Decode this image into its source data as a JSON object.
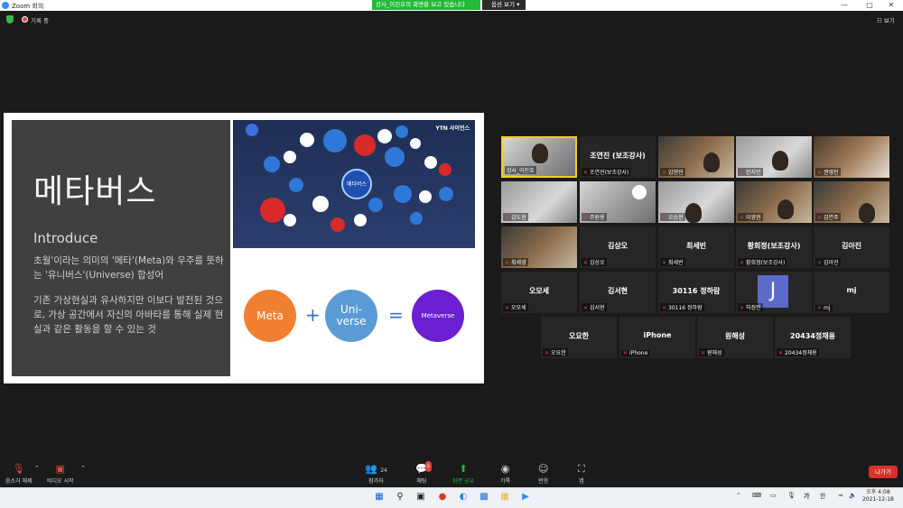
{
  "window": {
    "title": "Zoom 회의",
    "share_banner": "강사_이진호의 화면을 보고 있습니다",
    "view_options": "옵션 보기"
  },
  "top": {
    "recording_label": "기록 중",
    "view_label": "보기"
  },
  "slide": {
    "title": "메타버스",
    "subtitle": "Introduce",
    "para1": "초월'이라는 의미의 '메타'(Meta)와 우주를 뜻하는 '유니버스'(Universe) 합성어",
    "para2": "기존 가상현실과 유사하지만 이보다 발전된 것으로, 가상 공간에서 자신의 아바타를 통해 실제 현실과 같은 활동을 할 수 있는 것",
    "image_badge": "YTN 사이언스",
    "image_center": "메타버스",
    "circle1": "Meta",
    "circle2_line1": "Uni-",
    "circle2_line2": "verse",
    "circle3": "Metaverse",
    "plus": "+",
    "equals": "="
  },
  "participants": [
    {
      "name": "강사_이진호",
      "label": "",
      "video": true
    },
    {
      "name": "조연진(보조강사)",
      "label": "조연진 (보조강사)",
      "video": false
    },
    {
      "name": "김현민",
      "label": "",
      "video": true
    },
    {
      "name": "한지민",
      "label": "",
      "video": true
    },
    {
      "name": "권영민",
      "label": "",
      "video": true
    },
    {
      "name": "김도현",
      "label": "",
      "video": true
    },
    {
      "name": "주원용",
      "label": "",
      "video": true
    },
    {
      "name": "오승현",
      "label": "",
      "video": true
    },
    {
      "name": "이영현",
      "label": "",
      "video": true
    },
    {
      "name": "김연주",
      "label": "",
      "video": true
    },
    {
      "name": "최세영",
      "label": "",
      "video": true
    },
    {
      "name": "김상오",
      "label": "김상오",
      "video": false
    },
    {
      "name": "최세빈",
      "label": "최세빈",
      "video": false
    },
    {
      "name": "황희정(보조강사)",
      "label": "황희정(보조강사)",
      "video": false
    },
    {
      "name": "김아진",
      "label": "김아진",
      "video": false
    },
    {
      "name": "오모세",
      "label": "오모세",
      "video": false
    },
    {
      "name": "김서현",
      "label": "김서현",
      "video": false
    },
    {
      "name": "30116 정하람",
      "label": "30116 정하람",
      "video": false
    },
    {
      "name": "허정민",
      "label": "J",
      "video": false
    },
    {
      "name": "mj",
      "label": "mj",
      "video": false
    },
    {
      "name": "오요한",
      "label": "오요한",
      "video": false
    },
    {
      "name": "iPhone",
      "label": "iPhone",
      "video": false
    },
    {
      "name": "원해성",
      "label": "원해성",
      "video": false
    },
    {
      "name": "20434정채용",
      "label": "20434정채용",
      "video": false
    }
  ],
  "toolbar": {
    "mute": "음소거 해제",
    "video": "비디오 시작",
    "participants": "참가자",
    "participants_count": "24",
    "chat": "채팅",
    "chat_badge": "1",
    "share": "화면 공유",
    "record": "기록",
    "reactions": "반응",
    "apps": "앱",
    "leave": "나가기"
  },
  "taskbar": {
    "ime": "가",
    "ime2": "한",
    "time": "오후 4:08",
    "date": "2021-12-18"
  },
  "colors": {
    "share_green": "#25b83a",
    "leave_red": "#d9302c",
    "meta_orange": "#ef7f31",
    "universe_blue": "#5b9bd5",
    "metaverse_purple": "#6a1fd0",
    "active_speaker": "#f1ce23"
  }
}
